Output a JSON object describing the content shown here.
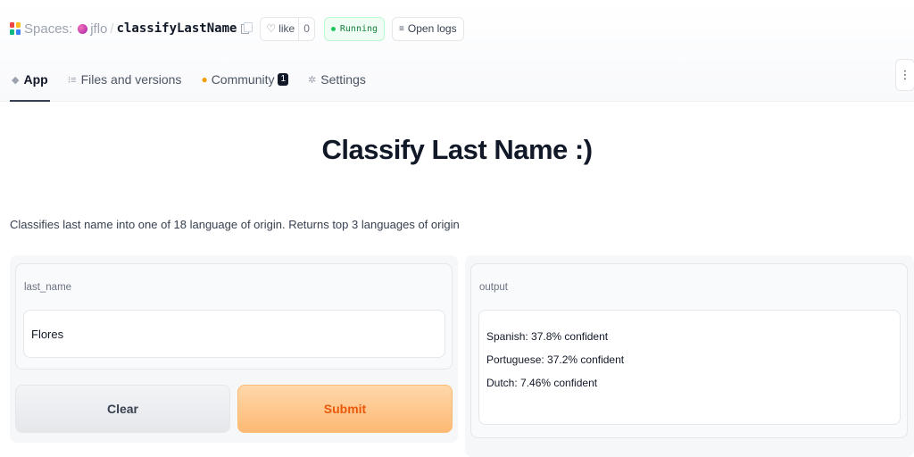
{
  "header": {
    "spaces_label": "Spaces:",
    "owner": "jflo",
    "separator": "/",
    "repo": "classifyLastName",
    "like_label": "like",
    "like_count": "0",
    "status": "Running",
    "logs_label": "Open logs",
    "icons": [
      "spaces-logo-icon",
      "avatar",
      "copy-icon",
      "heart-icon",
      "status-dot-icon",
      "logs-icon"
    ]
  },
  "tabs": [
    {
      "label": "App",
      "icon": "app-cube-icon",
      "active": true
    },
    {
      "label": "Files and versions",
      "icon": "files-icon",
      "active": false
    },
    {
      "label": "Community",
      "icon": "hand-wave-icon",
      "badge": "1",
      "active": false
    },
    {
      "label": "Settings",
      "icon": "gear-icon",
      "active": false
    }
  ],
  "menu_icon": "kebab-menu-icon",
  "app": {
    "title": "Classify Last Name :)",
    "description": "Classifies last name into one of 18 language of origin. Returns top 3 languages of origin"
  },
  "input": {
    "label": "last_name",
    "value": "Flores"
  },
  "buttons": {
    "clear": "Clear",
    "submit": "Submit"
  },
  "output": {
    "label": "output",
    "lines": [
      "Spanish: 37.8% confident",
      "Portuguese: 37.2% confident",
      "Dutch: 7.46% confident"
    ]
  },
  "colors": {
    "submit_bg": "#fdba74",
    "submit_text": "#ea580c",
    "running_text": "#15803d",
    "running_bg": "#f0fdf4"
  }
}
